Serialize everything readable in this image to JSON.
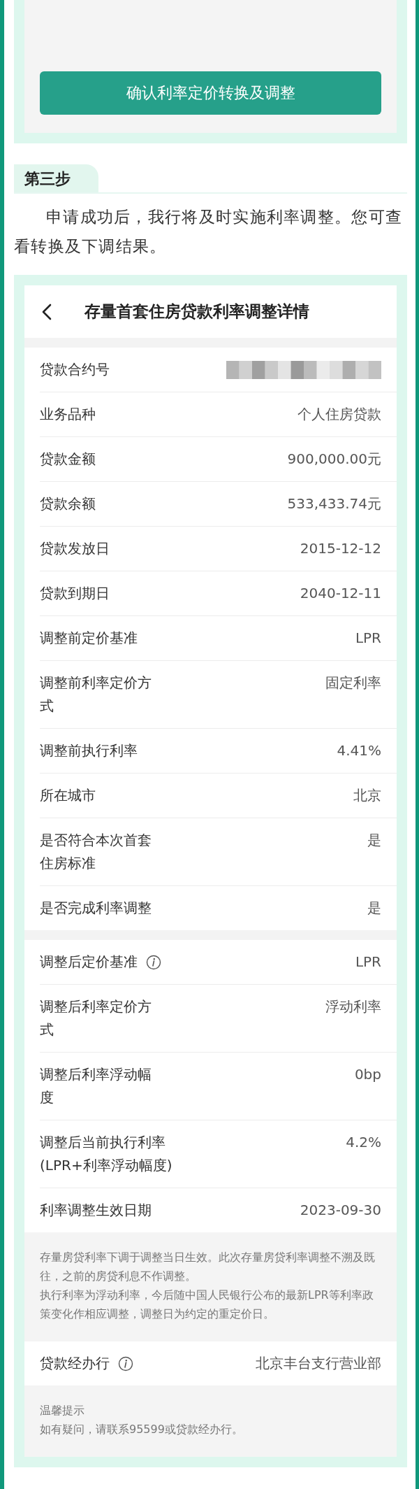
{
  "confirm_button": {
    "label": "确认利率定价转换及调整"
  },
  "step": {
    "label": "第三步",
    "text": "申请成功后，我行将及时实施利率调整。您可查看转换及下调结果。"
  },
  "detail": {
    "title": "存量首套住房贷款利率调整详情",
    "sections": [
      {
        "kind": "rows",
        "rows": [
          {
            "kind": "masked",
            "label": "贷款合约号",
            "info": false
          },
          {
            "kind": "text",
            "label": "业务品种",
            "value": "个人住房贷款",
            "info": false
          },
          {
            "kind": "text",
            "label": "贷款金额",
            "value": "900,000.00元",
            "info": false
          },
          {
            "kind": "text",
            "label": "贷款余额",
            "value": "533,433.74元",
            "info": false
          },
          {
            "kind": "text",
            "label": "贷款发放日",
            "value": "2015-12-12",
            "info": false
          },
          {
            "kind": "text",
            "label": "贷款到期日",
            "value": "2040-12-11",
            "info": false
          },
          {
            "kind": "text",
            "label": "调整前定价基准",
            "value": "LPR",
            "info": false
          },
          {
            "kind": "text",
            "label": "调整前利率定价方式",
            "value": "固定利率",
            "info": false
          },
          {
            "kind": "text",
            "label": "调整前执行利率",
            "value": "4.41%",
            "info": false
          },
          {
            "kind": "text",
            "label": "所在城市",
            "value": "北京",
            "info": false
          },
          {
            "kind": "text",
            "label": "是否符合本次首套住房标准",
            "value": "是",
            "info": false
          },
          {
            "kind": "text",
            "label": "是否完成利率调整",
            "value": "是",
            "info": false
          }
        ]
      },
      {
        "kind": "rows",
        "rows": [
          {
            "kind": "text",
            "label": "调整后定价基准",
            "value": "LPR",
            "info": true
          },
          {
            "kind": "text",
            "label": "调整后利率定价方式",
            "value": "浮动利率",
            "info": false
          },
          {
            "kind": "text",
            "label": "调整后利率浮动幅度",
            "value": "0bp",
            "info": false
          },
          {
            "kind": "text",
            "label": "调整后当前执行利率",
            "sublabel": "(LPR+利率浮动幅度)",
            "value": "4.2%",
            "info": false
          },
          {
            "kind": "text",
            "label": "利率调整生效日期",
            "value": "2023-09-30",
            "info": false
          }
        ]
      },
      {
        "kind": "note",
        "lines": [
          "存量房贷利率下调于调整当日生效。此次存量房贷利率调整不溯及既往，之前的房贷利息不作调整。",
          "执行利率为浮动利率，今后随中国人民银行公布的最新LPR等利率政策变化作相应调整，调整日为约定的重定价日。"
        ]
      },
      {
        "kind": "rows",
        "rows": [
          {
            "kind": "text",
            "label": "贷款经办行",
            "value": "北京丰台支行营业部",
            "info": true
          }
        ]
      },
      {
        "kind": "note",
        "lines": [
          "温馨提示",
          "如有疑问，请联系95599或贷款经办行。"
        ]
      }
    ]
  }
}
